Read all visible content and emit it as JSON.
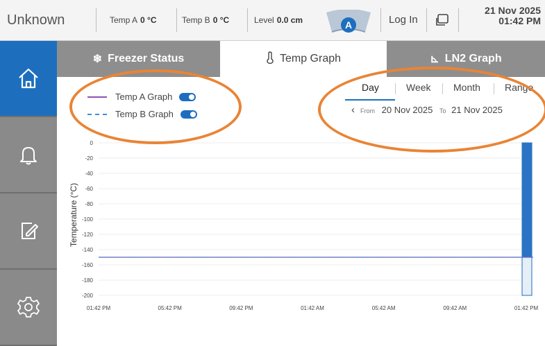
{
  "header": {
    "unit_name": "Unknown",
    "temp_a_label": "Temp A",
    "temp_a_value": "0 °C",
    "temp_b_label": "Temp B",
    "temp_b_value": "0 °C",
    "level_label": "Level",
    "level_value": "0.0 cm",
    "alert_badge": "A",
    "login_label": "Log In",
    "date": "21 Nov 2025",
    "time": "01:42 PM"
  },
  "nav": {
    "items": [
      {
        "icon": "home-icon"
      },
      {
        "icon": "bell-icon"
      },
      {
        "icon": "edit-icon"
      },
      {
        "icon": "gear-icon"
      }
    ]
  },
  "tabs": [
    {
      "label": "Freezer Status",
      "icon": "snowflake-icon",
      "glyph": "❄"
    },
    {
      "label": "Temp Graph",
      "icon": "thermometer-icon",
      "glyph": "🌡"
    },
    {
      "label": "LN2 Graph",
      "icon": "ln2-icon",
      "glyph": "⊾"
    }
  ],
  "legend": {
    "temp_a": "Temp A Graph",
    "temp_b": "Temp B Graph"
  },
  "range": {
    "options": [
      "Day",
      "Week",
      "Month",
      "Range"
    ],
    "selected": "Day",
    "from_label": "From",
    "from_date": "20 Nov 2025",
    "to_label": "To",
    "to_date": "21 Nov 2025"
  },
  "colors": {
    "accent": "#1d6fbe",
    "temp_a_line": "#8e4fb3",
    "temp_b_line": "#3d8ed8",
    "annotation": "#e98435"
  },
  "chart_data": {
    "type": "line",
    "ylabel": "Temperature (°C)",
    "ylim": [
      -200,
      0
    ],
    "yticks": [
      0,
      -20,
      -40,
      -60,
      -80,
      -100,
      -120,
      -140,
      -160,
      -180,
      -200
    ],
    "x_ticks": [
      "01:42 PM",
      "05:42 PM",
      "09:42 PM",
      "01:42 AM",
      "05:42 AM",
      "09:42 AM",
      "01:42 PM"
    ],
    "series": [
      {
        "name": "Temp A Graph",
        "style": "solid",
        "color": "#8e4fb3",
        "x": [
          "01:42 PM",
          "01:42 PM"
        ],
        "y": [
          -150,
          -150
        ]
      },
      {
        "name": "Temp B Graph",
        "style": "dashed",
        "color": "#3d8ed8",
        "x": [
          "01:42 PM",
          "01:42 PM"
        ],
        "y": [
          -150,
          -150
        ]
      }
    ],
    "level_bar": {
      "x": "01:42 PM",
      "top": 0,
      "bottom": -200,
      "shaded_to": -150
    },
    "grid": true
  }
}
